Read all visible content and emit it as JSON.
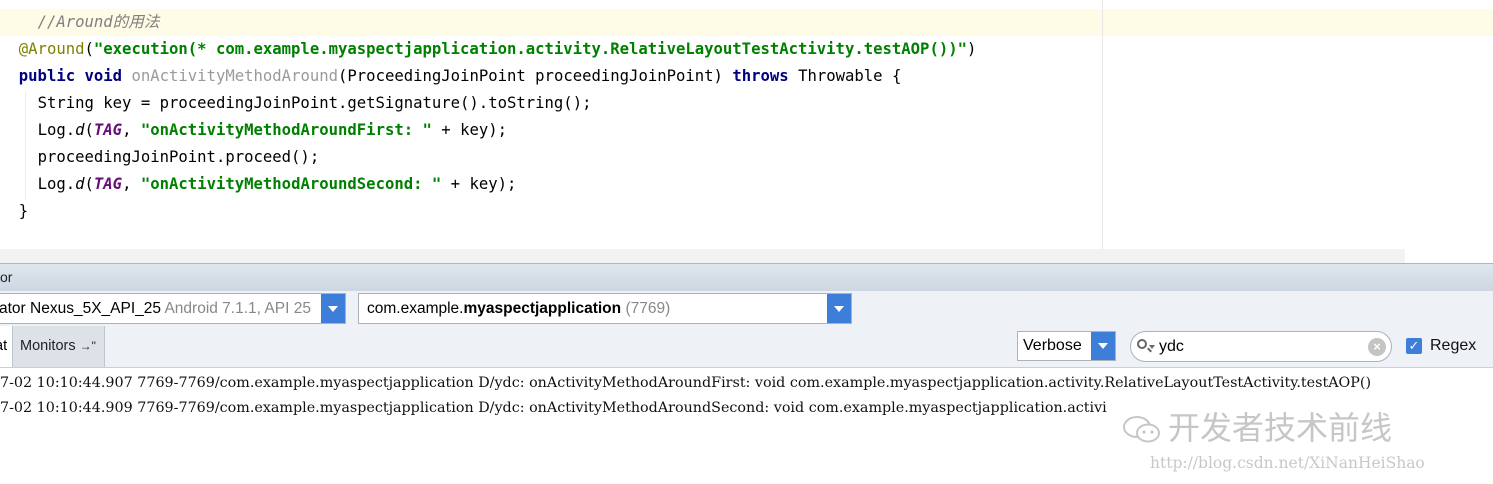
{
  "editor": {
    "comment": "//Around的用法",
    "line2": {
      "annotation": "@Around",
      "open": "(",
      "string": "\"execution(* com.example.myaspectjapplication.activity.RelativeLayoutTestActivity.testAOP())\"",
      "close": ")"
    },
    "line3": {
      "kw1": "public",
      "kw2": "void",
      "method": "onActivityMethodAround",
      "params": "(ProceedingJoinPoint proceedingJoinPoint)",
      "kw3": "throws",
      "rest": "Throwable {"
    },
    "line4": "String key = proceedingJoinPoint.getSignature().toString();",
    "line5": {
      "prefix": "Log.",
      "fn": "d",
      "open": "(",
      "tag": "TAG",
      "sep": ", ",
      "string": "\"onActivityMethodAroundFirst: \"",
      "rest": " + key);"
    },
    "line6": "proceedingJoinPoint.proceed();",
    "line7": {
      "prefix": "Log.",
      "fn": "d",
      "open": "(",
      "tag": "TAG",
      "sep": ", ",
      "string": "\"onActivityMethodAroundSecond: \"",
      "rest": " + key);"
    },
    "line8": "}"
  },
  "tool_window": {
    "title_fragment": "or"
  },
  "device_combo": {
    "name": "ator Nexus_5X_API_25",
    "detail": "Android 7.1.1, API 25"
  },
  "process_combo": {
    "prefix": "com.example.",
    "bold": "myaspectjapplication",
    "pid": "(7769)"
  },
  "tabs": {
    "logcat": "at",
    "monitors": "Monitors",
    "monitors_icon": "→\""
  },
  "log_level": "Verbose",
  "search": {
    "value": "ydc"
  },
  "regex": {
    "label": "Regex",
    "checked": true
  },
  "log_lines": [
    "7-02 10:10:44.907 7769-7769/com.example.myaspectjapplication D/ydc: onActivityMethodAroundFirst: void com.example.myaspectjapplication.activity.RelativeLayoutTestActivity.testAOP()",
    "7-02 10:10:44.909 7769-7769/com.example.myaspectjapplication D/ydc: onActivityMethodAroundSecond: void com.example.myaspectjapplication.activi"
  ],
  "watermark": {
    "text": "开发者技术前线",
    "url": "http://blog.csdn.net/XiNanHeiShao"
  },
  "colors": {
    "accent": "#3d7ed8",
    "string": "#008000",
    "keyword": "#000080",
    "annotation": "#808000"
  }
}
